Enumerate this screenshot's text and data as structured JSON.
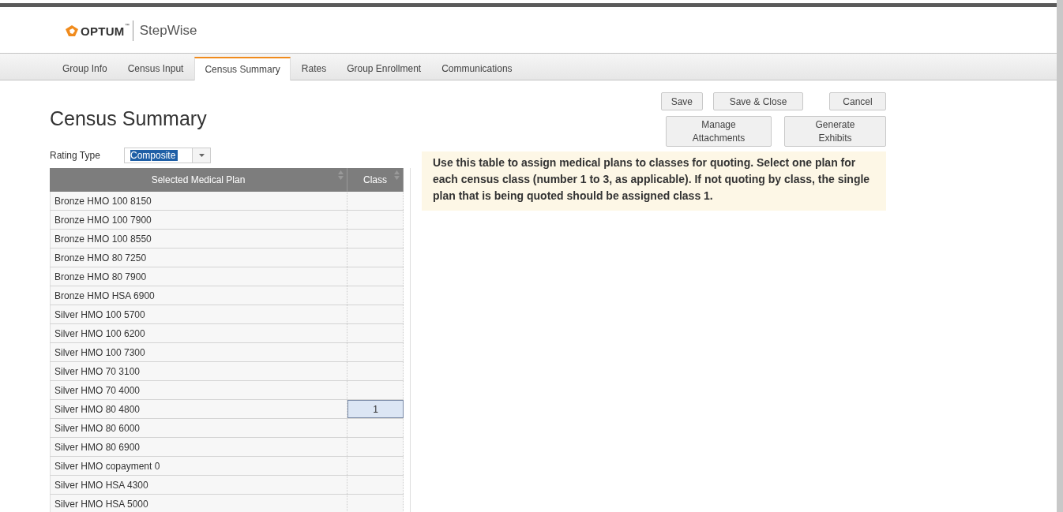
{
  "header": {
    "logo_text": "OPTUM",
    "logo_mark": "™",
    "app_name": "StepWise"
  },
  "tabs": [
    {
      "label": "Group Info",
      "selected": false
    },
    {
      "label": "Census Input",
      "selected": false
    },
    {
      "label": "Census Summary",
      "selected": true
    },
    {
      "label": "Rates",
      "selected": false
    },
    {
      "label": "Group Enrollment",
      "selected": false
    },
    {
      "label": "Communications",
      "selected": false
    }
  ],
  "page_title": "Census Summary",
  "actions": [
    [
      "Save",
      "Save & Close",
      "Cancel"
    ],
    [
      "Manage Attachments",
      "Generate Exhibits"
    ]
  ],
  "rating_type": {
    "label": "Rating Type",
    "value": "Composite",
    "highlighted": true
  },
  "notice": "Use this table to assign medical plans to classes for quoting. Select one plan for each census class (number 1 to 3, as applicable). If not quoting by class, the single plan that is being quoted should be assigned class 1.",
  "table": {
    "columns": [
      "Selected Medical Plan",
      "Class"
    ],
    "rows": [
      {
        "plan": "Bronze HMO 100 8150",
        "class": "",
        "selected": false
      },
      {
        "plan": "Bronze HMO 100 7900",
        "class": "",
        "selected": false
      },
      {
        "plan": "Bronze HMO 100 8550",
        "class": "",
        "selected": false
      },
      {
        "plan": "Bronze HMO 80 7250",
        "class": "",
        "selected": false
      },
      {
        "plan": "Bronze HMO 80 7900",
        "class": "",
        "selected": false
      },
      {
        "plan": "Bronze HMO HSA 6900",
        "class": "",
        "selected": false
      },
      {
        "plan": "Silver HMO 100 5700",
        "class": "",
        "selected": false
      },
      {
        "plan": "Silver HMO 100 6200",
        "class": "",
        "selected": false
      },
      {
        "plan": "Silver HMO 100 7300",
        "class": "",
        "selected": false
      },
      {
        "plan": "Silver HMO 70 3100",
        "class": "",
        "selected": false
      },
      {
        "plan": "Silver HMO 70 4000",
        "class": "",
        "selected": false
      },
      {
        "plan": "Silver HMO 80 4800",
        "class": "1",
        "selected": true
      },
      {
        "plan": "Silver HMO 80 6000",
        "class": "",
        "selected": false
      },
      {
        "plan": "Silver HMO 80 6900",
        "class": "",
        "selected": false
      },
      {
        "plan": "Silver HMO copayment 0",
        "class": "",
        "selected": false
      },
      {
        "plan": "Silver HMO HSA 4300",
        "class": "",
        "selected": false
      },
      {
        "plan": "Silver HMO HSA 5000",
        "class": "",
        "selected": false
      }
    ]
  }
}
